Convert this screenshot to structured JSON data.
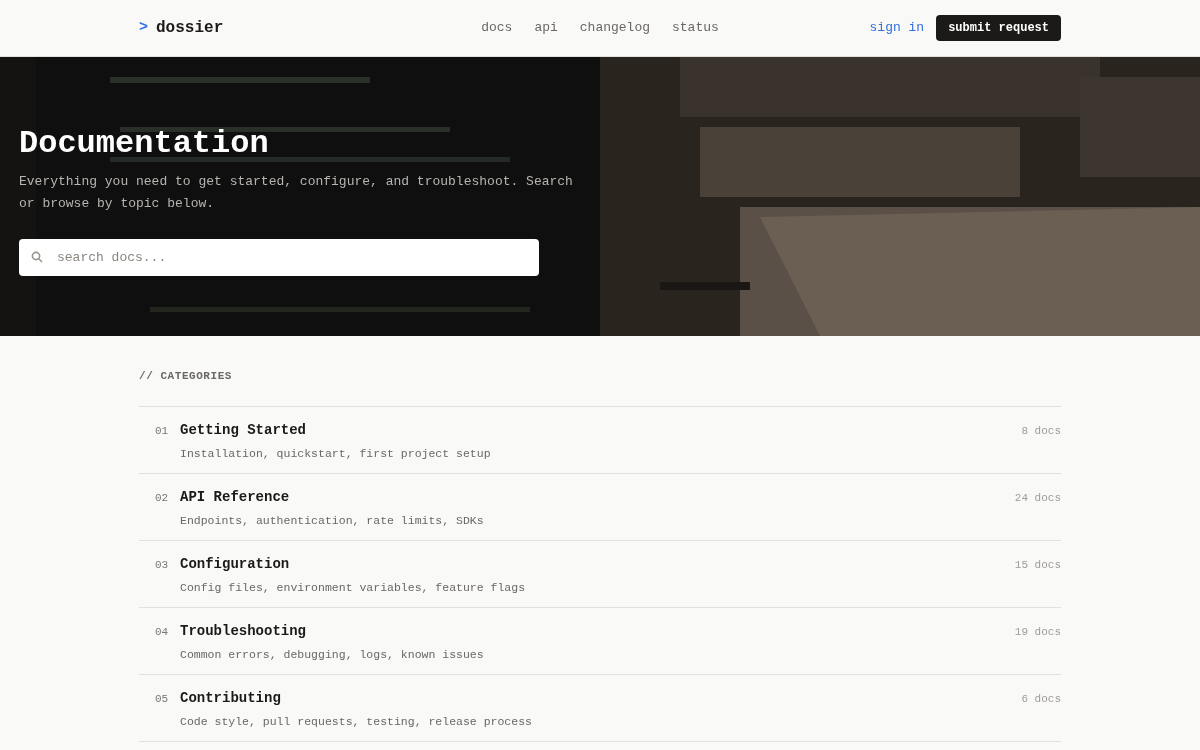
{
  "header": {
    "logo_mark": ">",
    "logo": "dossier",
    "nav": [
      "docs",
      "api",
      "changelog",
      "status"
    ],
    "sign_in": "sign in",
    "cta": "submit request"
  },
  "hero": {
    "kind": "picture",
    "title": "Documentation",
    "subtitle": "Everything you need to get started, configure, and troubleshoot. Search or browse by topic below.",
    "search": {
      "placeholder": "search docs..."
    }
  },
  "categories": {
    "heading": "// CATEGORIES",
    "items": [
      {
        "number": "01",
        "title": "Getting Started",
        "description": "Installation, quickstart, first project setup",
        "count": "8 docs"
      },
      {
        "number": "02",
        "title": "API Reference",
        "description": "Endpoints, authentication, rate limits, SDKs",
        "count": "24 docs"
      },
      {
        "number": "03",
        "title": "Configuration",
        "description": "Config files, environment variables, feature flags",
        "count": "15 docs"
      },
      {
        "number": "04",
        "title": "Troubleshooting",
        "description": "Common errors, debugging, logs, known issues",
        "count": "19 docs"
      },
      {
        "number": "05",
        "title": "Contributing",
        "description": "Code style, pull requests, testing, release process",
        "count": "6 docs"
      }
    ]
  }
}
